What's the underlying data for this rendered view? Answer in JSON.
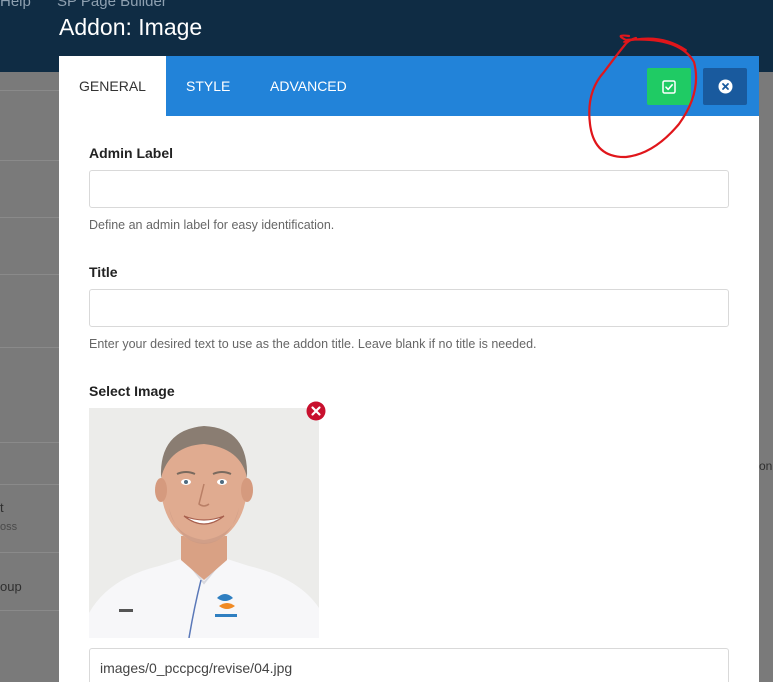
{
  "backdrop": {
    "topbar_items": [
      "Help",
      "SP Page Builder"
    ],
    "rows": [
      "t",
      "oss",
      "oup"
    ],
    "right_text": "on"
  },
  "modal": {
    "title": "Addon: Image",
    "tabs": [
      {
        "label": "GENERAL",
        "active": true
      },
      {
        "label": "STYLE",
        "active": false
      },
      {
        "label": "ADVANCED",
        "active": false
      }
    ],
    "save_icon": "check-square-icon",
    "close_icon": "close-circle-icon",
    "colors": {
      "header": "#2283d9",
      "save": "#1fcb64",
      "close": "#195a9e",
      "remove": "#c8102e",
      "annotation": "#e0161b"
    }
  },
  "form": {
    "admin_label": {
      "label": "Admin Label",
      "value": "",
      "help": "Define an admin label for easy identification."
    },
    "title": {
      "label": "Title",
      "value": "",
      "help": "Enter your desired text to use as the addon title. Leave blank if no title is needed."
    },
    "image": {
      "label": "Select Image",
      "path": "images/0_pccpcg/revise/04.jpg",
      "remove_icon": "remove-image-icon"
    }
  }
}
